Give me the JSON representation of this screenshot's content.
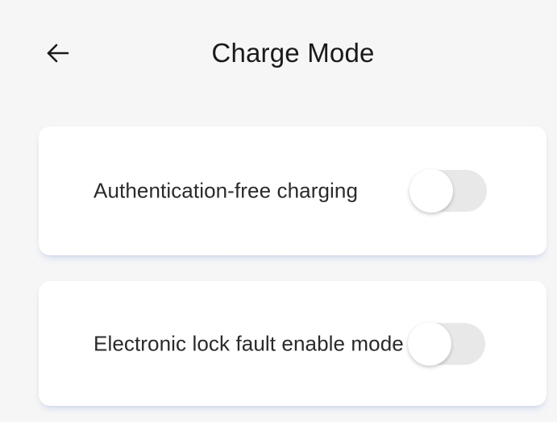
{
  "header": {
    "back_icon": "arrow-left-icon",
    "title": "Charge Mode"
  },
  "settings": [
    {
      "label": "Authentication-free charging",
      "enabled": false
    },
    {
      "label": "Electronic lock fault enable mode",
      "enabled": false
    }
  ],
  "colors": {
    "background": "#f6f6f6",
    "card": "#ffffff",
    "toggle_off_track": "#e8e8e8",
    "toggle_knob": "#ffffff",
    "text": "#1a1a1a"
  }
}
